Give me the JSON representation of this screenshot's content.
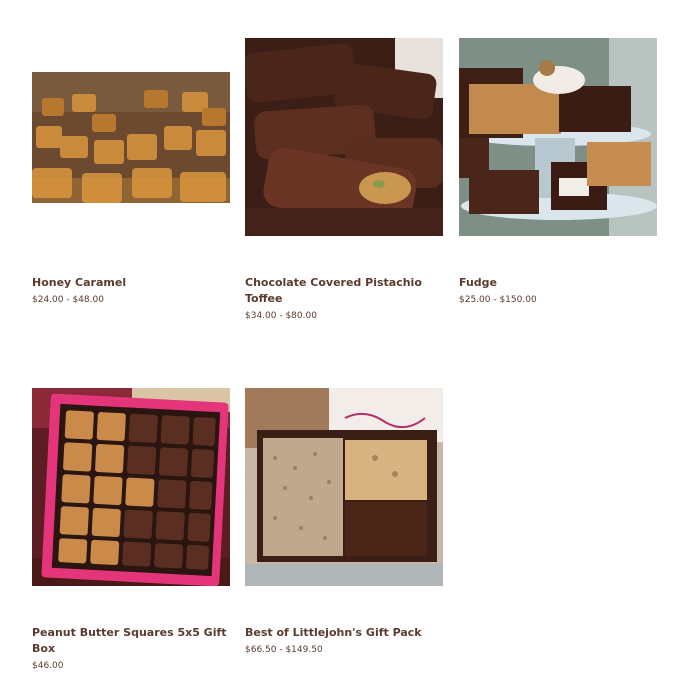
{
  "products": [
    {
      "name": "Honey Caramel",
      "price": "$24.00 - $48.00",
      "image_icon": "honey-caramel-image"
    },
    {
      "name": "Chocolate Covered Pistachio Toffee",
      "price": "$34.00 - $80.00",
      "image_icon": "pistachio-toffee-image"
    },
    {
      "name": "Fudge",
      "price": "$25.00 - $150.00",
      "image_icon": "fudge-image"
    },
    {
      "name": "Peanut Butter Squares 5x5 Gift Box",
      "price": "$46.00",
      "image_icon": "peanut-butter-squares-image"
    },
    {
      "name": "Best of Littlejohn's Gift Pack",
      "price": "$66.50 - $149.50",
      "image_icon": "gift-pack-image"
    }
  ],
  "colors": {
    "title_text": "#5a3b2d",
    "price_text": "#5a3b2d",
    "background": "#ffffff"
  }
}
